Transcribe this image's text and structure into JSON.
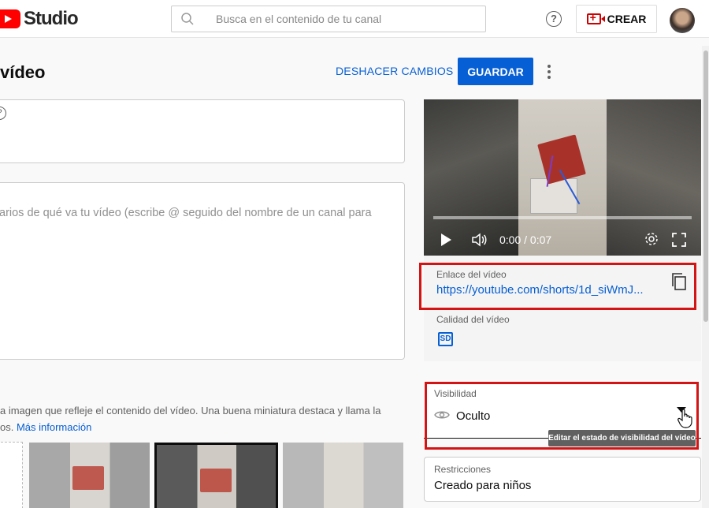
{
  "header": {
    "logo_text": "Studio",
    "search_placeholder": "Busca en el contenido de tu canal",
    "help_symbol": "?",
    "create_label": "CREAR"
  },
  "page": {
    "title": " vídeo",
    "undo_label": "DESHACER CAMBIOS",
    "save_label": "GUARDAR"
  },
  "form": {
    "title_help": "?",
    "description_placeholder": "arios de qué va tu vídeo (escribe @ seguido del nombre de un canal para",
    "thumbnail_text_1": "a imagen que refleje el contenido del vídeo. Una buena miniatura destaca y llama la",
    "thumbnail_text_2": "os.",
    "more_info_label": "Más información"
  },
  "player": {
    "time": "0:00 / 0:07"
  },
  "details": {
    "link_label": "Enlace del vídeo",
    "link_value": "https://youtube.com/shorts/1d_siWmJ...",
    "quality_label": "Calidad del vídeo",
    "quality_badge": "SD"
  },
  "visibility": {
    "label": "Visibilidad",
    "value": "Oculto",
    "tooltip": "Editar el estado de visibilidad del vídeo"
  },
  "restrictions": {
    "label": "Restricciones",
    "value": "Creado para niños"
  },
  "colors": {
    "accent": "#065fd4",
    "highlight": "#d41414",
    "brand": "#ff0000"
  }
}
